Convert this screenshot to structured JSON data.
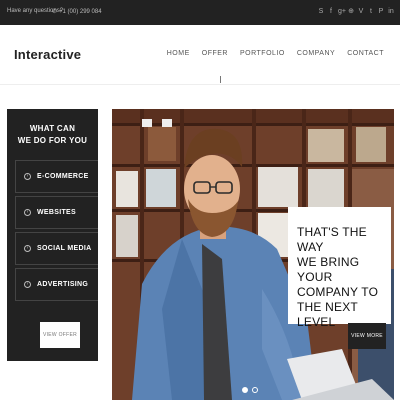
{
  "topbar": {
    "question": "Have any questions?",
    "phone": "+1 (00) 299 084",
    "socials": [
      {
        "icon": "skype-icon",
        "glyph": "S"
      },
      {
        "icon": "facebook-icon",
        "glyph": "f"
      },
      {
        "icon": "google-plus-icon",
        "glyph": "g+"
      },
      {
        "icon": "vk-icon",
        "glyph": "⊕"
      },
      {
        "icon": "vimeo-icon",
        "glyph": "V"
      },
      {
        "icon": "twitter-icon",
        "glyph": "t"
      },
      {
        "icon": "pinterest-icon",
        "glyph": "P"
      },
      {
        "icon": "linkedin-icon",
        "glyph": "in"
      }
    ]
  },
  "header": {
    "logo": "Interactive",
    "nav": [
      "HOME",
      "OFFER",
      "PORTFOLIO",
      "COMPANY",
      "CONTACT"
    ]
  },
  "panel": {
    "title_line1": "WHAT CAN",
    "title_line2": "WE DO FOR YOU",
    "items": [
      "E-COMMERCE",
      "WEBSITES",
      "SOCIAL MEDIA",
      "ADVERTISING"
    ],
    "button": "VIEW OFFER"
  },
  "hero": {
    "headline_line1": "THAT'S THE WAY",
    "headline_line2": "WE BRING YOUR",
    "headline_line3": "COMPANY TO",
    "headline_line4": "THE NEXT LEVEL",
    "button": "VIEW MORE",
    "active_slide": 1
  },
  "colors": {
    "dark": "#222222",
    "white": "#ffffff",
    "hero_bg": "#6a3a26"
  }
}
